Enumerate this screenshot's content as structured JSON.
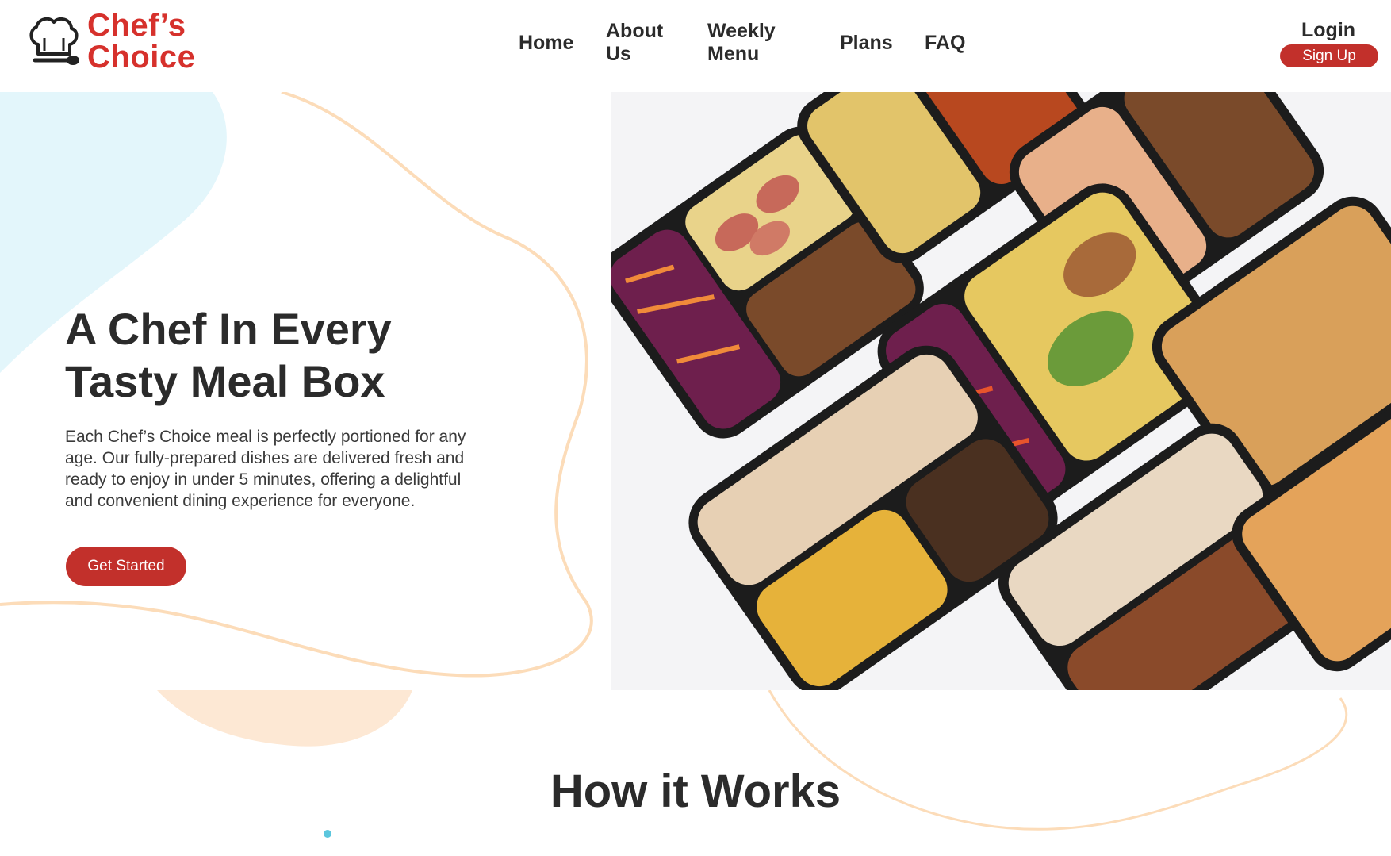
{
  "brand": {
    "line1": "Chef’s",
    "line2": "Choice",
    "icon": "chef-hat-icon",
    "color": "#d6312c"
  },
  "nav": {
    "home": "Home",
    "about_line1": "About",
    "about_line2": "Us",
    "weekly_line1": "Weekly",
    "weekly_line2": "Menu",
    "plans": "Plans",
    "faq": "FAQ"
  },
  "auth": {
    "login": "Login",
    "signup": "Sign Up"
  },
  "hero": {
    "title_line1": "A Chef In Every",
    "title_line2": "Tasty Meal Box",
    "description": "Each Chef’s Choice meal is perfectly portioned for any age. Our fully-prepared dishes are delivered fresh and ready to enjoy in under 5 minutes, offering a delightful and convenient dining experience for everyone.",
    "cta": "Get Started",
    "image": "meal-prep-containers-photo"
  },
  "how_it_works": {
    "title": "How it Works"
  },
  "colors": {
    "accent": "#c2302b",
    "blob_blue": "#e3f6fb",
    "blob_peach": "#fde8d4",
    "line_peach": "#fcdcb9"
  }
}
